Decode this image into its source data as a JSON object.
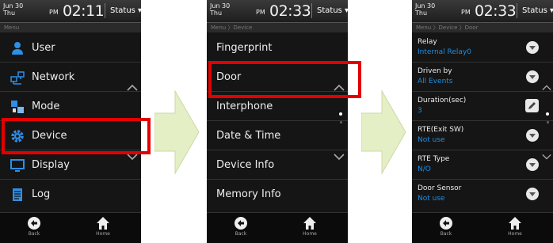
{
  "screens": [
    {
      "date": "Jun 30",
      "day": "Thu",
      "ampm": "PM",
      "time": "02:11",
      "status": "Status ▾",
      "breadcrumb": "Menu",
      "items": [
        "User",
        "Network",
        "Mode",
        "Device",
        "Display",
        "Log"
      ],
      "icons": [
        "user-icon",
        "network-icon",
        "mode-icon",
        "gear-icon",
        "display-icon",
        "log-icon"
      ],
      "back": "Back",
      "home": "Home"
    },
    {
      "date": "Jun 30",
      "day": "Thu",
      "ampm": "PM",
      "time": "02:33",
      "status": "Status ▾",
      "breadcrumb": "Menu 〉Device",
      "items": [
        "Fingerprint",
        "Door",
        "Interphone",
        "Date & Time",
        "Device Info",
        "Memory Info"
      ],
      "back": "Back",
      "home": "Home"
    },
    {
      "date": "Jun 30",
      "day": "Thu",
      "ampm": "PM",
      "time": "02:33",
      "status": "Status ▾",
      "breadcrumb": "Menu 〉Device 〉Door",
      "props": [
        {
          "label": "Relay",
          "value": "Internal Relay0",
          "control": "dropdown"
        },
        {
          "label": "Driven by",
          "value": "All Events",
          "control": "dropdown"
        },
        {
          "label": "Duration(sec)",
          "value": "3",
          "control": "edit"
        },
        {
          "label": "RTE(Exit SW)",
          "value": "Not use",
          "control": "dropdown"
        },
        {
          "label": "RTE Type",
          "value": "N/O",
          "control": "dropdown"
        },
        {
          "label": "Door Sensor",
          "value": "Not use",
          "control": "dropdown"
        }
      ],
      "back": "Back",
      "home": "Home"
    }
  ],
  "colors": {
    "highlight": "#e30000",
    "value_text": "#1a8fe8",
    "arrow_fill": "#e4efc6"
  }
}
